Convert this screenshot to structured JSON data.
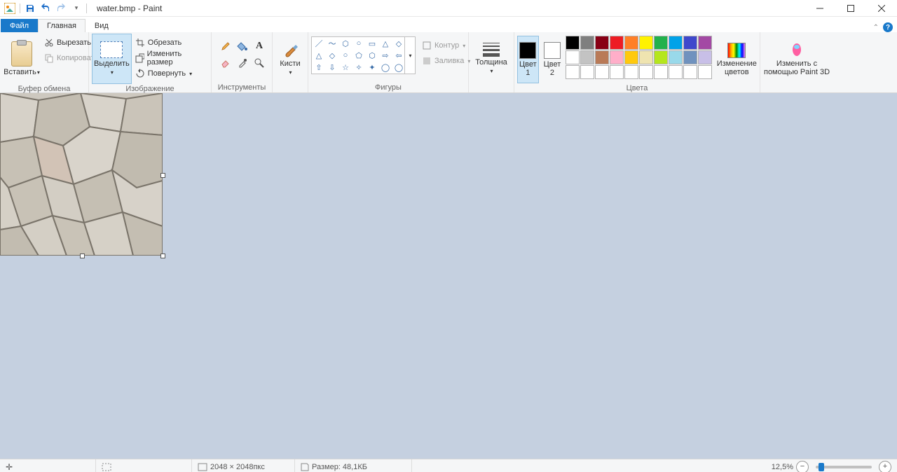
{
  "title": "water.bmp - Paint",
  "tabs": {
    "file": "Файл",
    "home": "Главная",
    "view": "Вид"
  },
  "groups": {
    "clipboard": {
      "label": "Буфер обмена",
      "paste": "Вставить",
      "cut": "Вырезать",
      "copy": "Копировать"
    },
    "image": {
      "label": "Изображение",
      "select": "Выделить",
      "crop": "Обрезать",
      "resize": "Изменить размер",
      "rotate": "Повернуть"
    },
    "tools": {
      "label": "Инструменты"
    },
    "brushes": {
      "label": "Кисти"
    },
    "shapes": {
      "label": "Фигуры",
      "outline": "Контур",
      "fill": "Заливка"
    },
    "size": {
      "label": "Толщина"
    },
    "colors": {
      "label": "Цвета",
      "color1": "Цвет\n1",
      "color2": "Цвет\n2",
      "edit": "Изменение\nцветов"
    },
    "paint3d": {
      "label": "Изменить с\nпомощью Paint 3D"
    }
  },
  "palette_row1": [
    "#000000",
    "#7f7f7f",
    "#880015",
    "#ed1c24",
    "#ff7f27",
    "#fff200",
    "#22b14c",
    "#00a2e8",
    "#3f48cc",
    "#a349a4"
  ],
  "palette_row2": [
    "#ffffff",
    "#c3c3c3",
    "#b97a57",
    "#ffaec9",
    "#ffc90e",
    "#efe4b0",
    "#b5e61d",
    "#99d9ea",
    "#7092be",
    "#c8bfe7"
  ],
  "palette_row3": [
    "#ffffff",
    "#ffffff",
    "#ffffff",
    "#ffffff",
    "#ffffff",
    "#ffffff",
    "#ffffff",
    "#ffffff",
    "#ffffff",
    "#ffffff"
  ],
  "color1_value": "#000000",
  "color2_value": "#ffffff",
  "status": {
    "pos_icon": "+",
    "dimensions": "2048 × 2048пкс",
    "size": "Размер: 48,1КБ",
    "zoom": "12,5%"
  }
}
